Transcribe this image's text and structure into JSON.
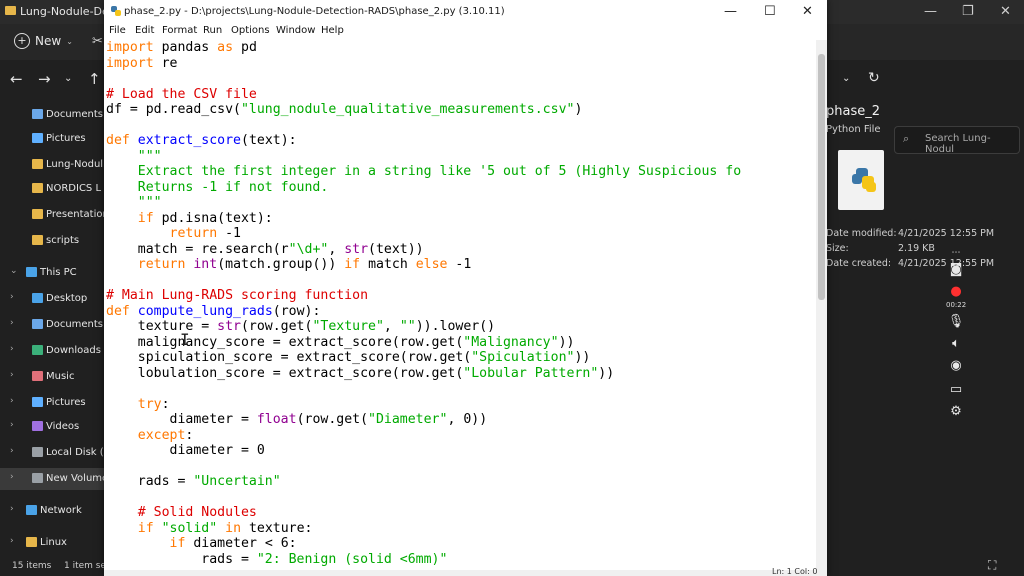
{
  "explorer": {
    "title": "Lung-Nodule-Detec",
    "new_label": "New",
    "search_placeholder": "Search Lung-Nodul",
    "sidebar": [
      {
        "label": "Documents",
        "color": "#6aa7e8"
      },
      {
        "label": "Pictures",
        "color": "#5fb0ff"
      },
      {
        "label": "Lung-Nodul",
        "color": "#e6b64a"
      },
      {
        "label": "NORDICS L",
        "color": "#e6b64a"
      },
      {
        "label": "Presentation",
        "color": "#e6b64a"
      },
      {
        "label": "scripts",
        "color": "#e6b64a"
      },
      {
        "label": "This PC",
        "color": "#4aa3e8"
      },
      {
        "label": "Desktop",
        "color": "#4aa3e8"
      },
      {
        "label": "Documents",
        "color": "#6aa7e8"
      },
      {
        "label": "Downloads",
        "color": "#3bb07a"
      },
      {
        "label": "Music",
        "color": "#e0707a"
      },
      {
        "label": "Pictures",
        "color": "#5fb0ff"
      },
      {
        "label": "Videos",
        "color": "#a070e0"
      },
      {
        "label": "Local Disk (C:)",
        "color": "#9aa0a6"
      },
      {
        "label": "New Volume",
        "color": "#9aa0a6"
      },
      {
        "label": "Network",
        "color": "#4aa3e8"
      },
      {
        "label": "Linux",
        "color": "#e6b64a"
      }
    ],
    "status_items": "15 items",
    "status_selected": "1 item se",
    "details": {
      "name": "phase_2",
      "type": "Python File",
      "rows": [
        {
          "label": "Date modified:",
          "value": "4/21/2025 12:55 PM"
        },
        {
          "label": "Size:",
          "value": "2.19 KB"
        },
        {
          "label": "Date created:",
          "value": "4/21/2025 12:55 PM"
        }
      ]
    },
    "recorder": {
      "timer": "00:22"
    }
  },
  "idle": {
    "title": "phase_2.py - D:\\projects\\Lung-Nodule-Detection-RADS\\phase_2.py (3.10.11)",
    "menu": [
      "File",
      "Edit",
      "Format",
      "Run",
      "Options",
      "Window",
      "Help"
    ],
    "status": "Ln: 1  Col: 0"
  }
}
